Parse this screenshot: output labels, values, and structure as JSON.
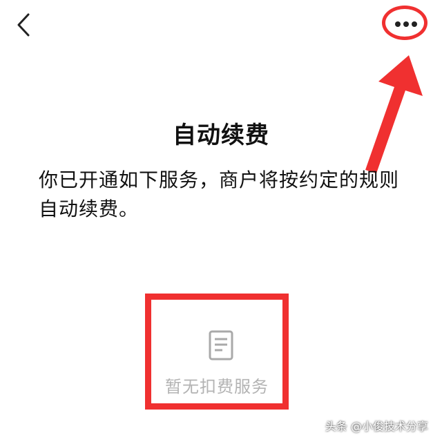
{
  "header": {
    "back_icon": "chevron-left-icon",
    "more_icon": "more-dots-icon"
  },
  "page": {
    "title": "自动续费",
    "description": "你已开通如下服务，商户将按约定的规则自动续费。"
  },
  "empty_state": {
    "icon": "document-icon",
    "label": "暂无扣费服务"
  },
  "annotation": {
    "color": "#f03030"
  },
  "watermark": {
    "text": "头条 @小俊技术分享"
  }
}
